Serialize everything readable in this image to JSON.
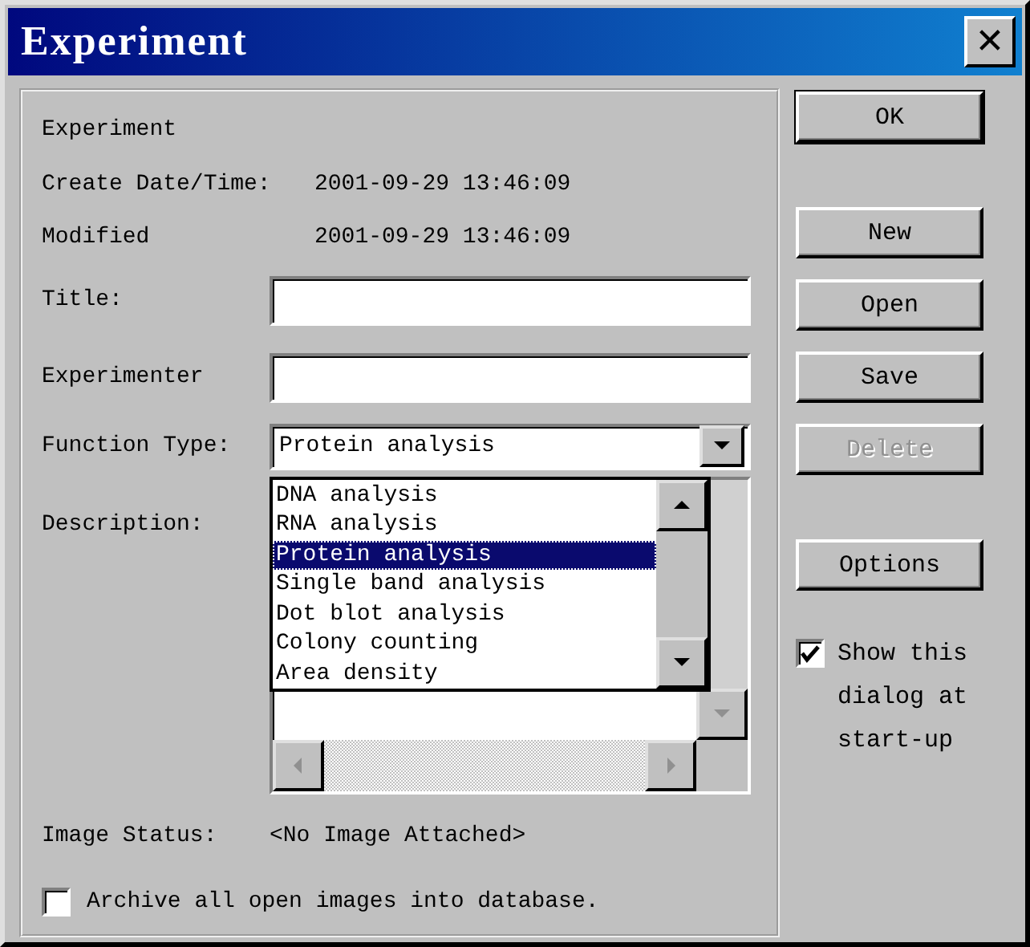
{
  "window": {
    "title": "Experiment",
    "close": "✕"
  },
  "info": [
    {
      "label": "Experiment"
    },
    {
      "label": "Create Date/Time:",
      "value": "2001-09-29 13:46:09"
    },
    {
      "label": "Modified",
      "value": "2001-09-29 13:46:09"
    }
  ],
  "fields": [
    {
      "label": "Title:"
    },
    {
      "label": "Experimenter"
    }
  ],
  "function_type": {
    "label": "Function Type:",
    "value": "Protein analysis",
    "expanded": true,
    "options": [
      {
        "label": "DNA analysis",
        "selected": false
      },
      {
        "label": "RNA analysis",
        "selected": false
      },
      {
        "label": "Protein analysis",
        "selected": true
      },
      {
        "label": "Single band analysis",
        "selected": false
      },
      {
        "label": "Dot blot analysis",
        "selected": false
      },
      {
        "label": "Colony counting",
        "selected": false
      },
      {
        "label": "Area density",
        "selected": false
      }
    ]
  },
  "description": {
    "label": "Description:"
  },
  "image_status": {
    "label": "Image Status:",
    "value": "<No Image Attached>"
  },
  "archive": {
    "label": "Archive all open images into database.",
    "checked": false
  },
  "button_groups": [
    [
      {
        "label": "OK",
        "default": true,
        "disabled": false
      }
    ],
    [
      {
        "label": "New",
        "default": false,
        "disabled": false
      },
      {
        "label": "Open",
        "default": false,
        "disabled": false
      },
      {
        "label": "Save",
        "default": false,
        "disabled": false
      },
      {
        "label": "Delete",
        "default": false,
        "disabled": true
      }
    ],
    [
      {
        "label": "Options",
        "default": false,
        "disabled": false
      }
    ]
  ],
  "show_dialog": {
    "label": "Show this dialog at start-up",
    "checked": true
  }
}
